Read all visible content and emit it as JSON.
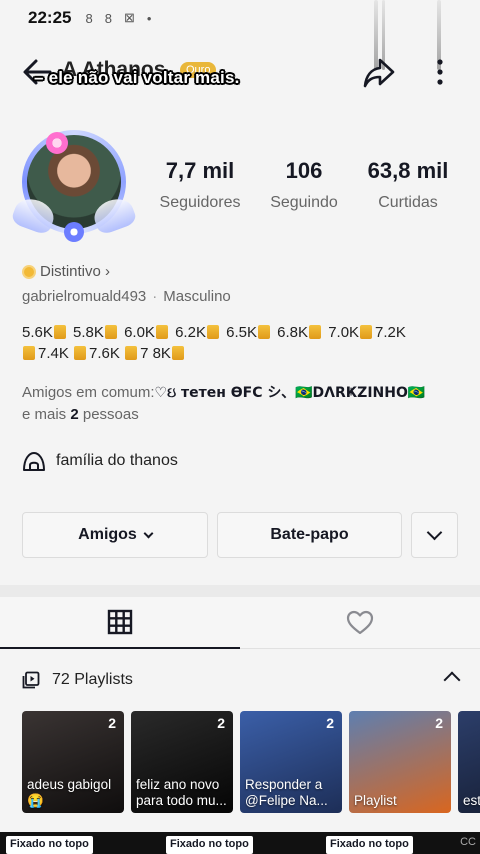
{
  "status_bar": {
    "time": "22:25",
    "icons": [
      "8",
      "8",
      "⊠",
      "•"
    ]
  },
  "header": {
    "title": "A Athanos",
    "tier_badge": "Ouro",
    "caption_overlay": "– ele não vai voltar mais.",
    "back_icon": "arrow-left-icon",
    "share_icon": "share-arrow-icon",
    "more_icon": "vertical-dots-icon"
  },
  "stats": [
    {
      "value": "7,7 mil",
      "label": "Seguidores"
    },
    {
      "value": "106",
      "label": "Seguindo"
    },
    {
      "value": "63,8 mil",
      "label": "Curtidas"
    }
  ],
  "profile": {
    "distintivo": "Distintivo ›",
    "handle": "gabrielromuald493",
    "gender": "Masculino",
    "bio_items": [
      "5.6K",
      "5.8K",
      "6.0K",
      "6.2K",
      "6.5K",
      "6.8K",
      "7.0K",
      "7.2K",
      "7.4K",
      "7.6K",
      "7 8K"
    ],
    "mutual_prefix": "Amigos em comum:",
    "mutual_names": "♡ઇ тетен ϴFC シ、🇧🇷DΛRҜZINHO🇧🇷",
    "mutual_suffix_pre": "e mais",
    "mutual_count": "2",
    "mutual_suffix_post": "pessoas",
    "group": "família do  thanos"
  },
  "buttons": {
    "friends": "Amigos",
    "chat": "Bate-papo"
  },
  "playlists": {
    "header": "72 Playlists",
    "items": [
      {
        "title": "adeus gabigol 😭",
        "count": "2",
        "color1": "#3a3433",
        "color2": "#0f0d0d"
      },
      {
        "title": "feliz ano novo para todo mu...",
        "count": "2",
        "color1": "#2a2a2a",
        "color2": "#050505"
      },
      {
        "title": "Responder a @Felipe Na...",
        "count": "2",
        "color1": "#3b5fa8",
        "color2": "#1d2e57"
      },
      {
        "title": "Playlist",
        "count": "2",
        "color1": "#5e7fb0",
        "color2": "#d9661f"
      },
      {
        "title": "est mu",
        "count": "",
        "color1": "#2c3e6a",
        "color2": "#141c30"
      }
    ]
  },
  "pinned": [
    "Fixado no topo",
    "Fixado no topo",
    "Fixado no topo"
  ],
  "watermark": "CC"
}
